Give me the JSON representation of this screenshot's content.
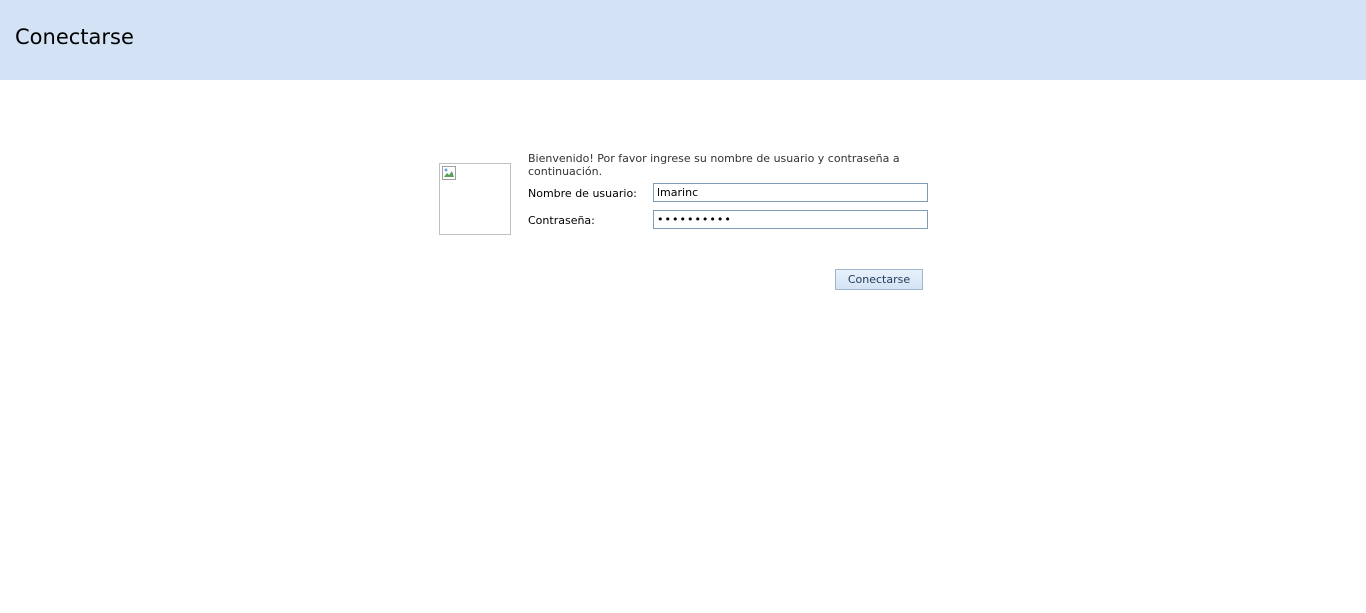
{
  "header": {
    "title": "Conectarse"
  },
  "login": {
    "welcome_message": "Bienvenido! Por favor ingrese su nombre de usuario y contraseña a continuación.",
    "username_label": "Nombre de usuario:",
    "username_value": "lmarinc",
    "password_label": "Contraseña:",
    "password_value": "••••••••••",
    "submit_label": "Conectarse"
  },
  "colors": {
    "header_background": "#d3e3f5",
    "input_border": "#7f9db9",
    "button_background": "#d3e3f5"
  },
  "icons": {
    "login_image": "broken-image-icon"
  }
}
